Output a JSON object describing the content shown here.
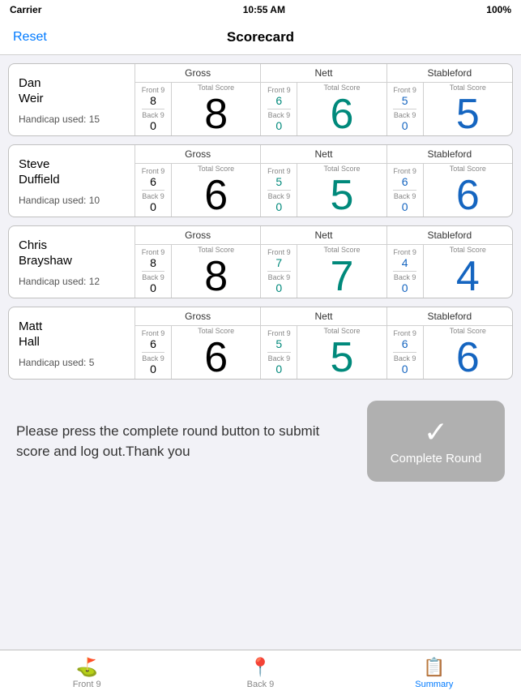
{
  "statusBar": {
    "carrier": "Carrier",
    "time": "10:55 AM",
    "battery": "100%"
  },
  "navBar": {
    "title": "Scorecard",
    "resetLabel": "Reset"
  },
  "players": [
    {
      "id": "dan-weir",
      "name": "Dan\nWeir",
      "handicap": "Handicap used: 15",
      "gross": {
        "front9": "8",
        "back9": "0",
        "total": "8"
      },
      "nett": {
        "front9": "6",
        "back9": "0",
        "total": "6"
      },
      "stableford": {
        "front9": "5",
        "back9": "0",
        "total": "5"
      }
    },
    {
      "id": "steve-duffield",
      "name": "Steve\nDuffield",
      "handicap": "Handicap used: 10",
      "gross": {
        "front9": "6",
        "back9": "0",
        "total": "6"
      },
      "nett": {
        "front9": "5",
        "back9": "0",
        "total": "5"
      },
      "stableford": {
        "front9": "6",
        "back9": "0",
        "total": "6"
      }
    },
    {
      "id": "chris-brayshaw",
      "name": "Chris\nBrayshaw",
      "handicap": "Handicap used: 12",
      "gross": {
        "front9": "8",
        "back9": "0",
        "total": "8"
      },
      "nett": {
        "front9": "7",
        "back9": "0",
        "total": "7"
      },
      "stableford": {
        "front9": "4",
        "back9": "0",
        "total": "4"
      }
    },
    {
      "id": "matt-hall",
      "name": "Matt\nHall",
      "handicap": "Handicap used: 5",
      "gross": {
        "front9": "6",
        "back9": "0",
        "total": "6"
      },
      "nett": {
        "front9": "5",
        "back9": "0",
        "total": "5"
      },
      "stableford": {
        "front9": "6",
        "back9": "0",
        "total": "6"
      }
    }
  ],
  "bottomMessage": "Please press the complete round button to submit score and log out.Thank you",
  "completeRoundLabel": "Complete Round",
  "tabs": [
    {
      "id": "front9",
      "label": "Front 9",
      "icon": "⛳",
      "active": false
    },
    {
      "id": "back9",
      "label": "Back 9",
      "icon": "📍",
      "active": false
    },
    {
      "id": "summary",
      "label": "Summary",
      "icon": "📋",
      "active": true
    }
  ],
  "sectionHeaders": {
    "gross": "Gross",
    "nett": "Nett",
    "stableford": "Stableford",
    "front9": "Front 9",
    "back9": "Back 9",
    "totalScore": "Total Score"
  }
}
